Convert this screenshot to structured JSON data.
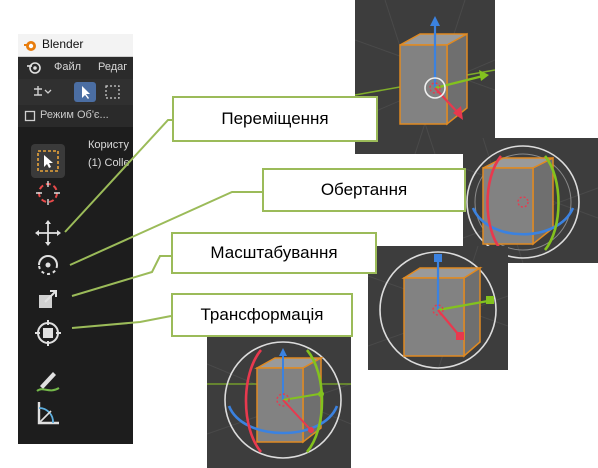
{
  "window": {
    "app_title": "Blender"
  },
  "menubar": {
    "file_label": "Файл",
    "edit_label": "Редаг"
  },
  "modebar": {
    "mode_label": "Режим Об'є..."
  },
  "viewport_overlay": {
    "view_label": "Користу",
    "collection_label": "(1) Colle"
  },
  "labels": {
    "move": "Переміщення",
    "rotate": "Обертання",
    "scale": "Масштабування",
    "transform": "Трансформація"
  },
  "colors": {
    "callout_border": "#9bbb59",
    "axis_x": "#e8394e",
    "axis_y": "#83c21e",
    "axis_z": "#3b82e0",
    "cube_outline": "#e08a22",
    "active_tool": "#5a7aa8"
  },
  "icons": [
    "blender-logo-icon",
    "select-box-icon",
    "cursor-icon",
    "move-icon",
    "rotate-icon",
    "scale-icon",
    "transform-icon",
    "annotate-icon",
    "measure-icon"
  ]
}
